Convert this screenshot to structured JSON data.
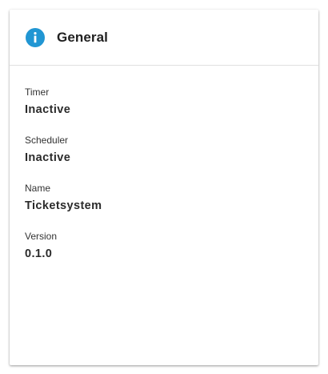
{
  "card": {
    "title": "General",
    "icon": "info-icon",
    "accent_color": "#2196d3"
  },
  "fields": [
    {
      "label": "Timer",
      "value": "Inactive"
    },
    {
      "label": "Scheduler",
      "value": "Inactive"
    },
    {
      "label": "Name",
      "value": "Ticketsystem"
    },
    {
      "label": "Version",
      "value": "0.1.0"
    }
  ]
}
